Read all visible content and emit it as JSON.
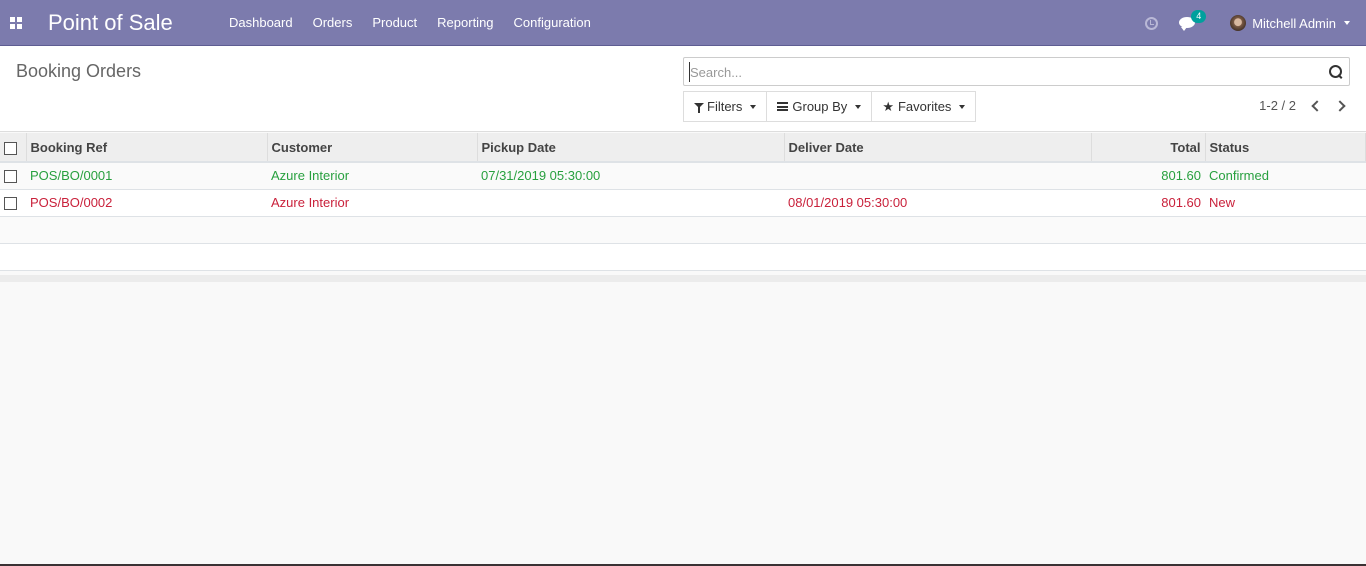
{
  "navbar": {
    "app_title": "Point of Sale",
    "menu": [
      "Dashboard",
      "Orders",
      "Product",
      "Reporting",
      "Configuration"
    ],
    "chat_count": "4",
    "user_name": "Mitchell Admin"
  },
  "control_panel": {
    "title": "Booking Orders",
    "search_placeholder": "Search...",
    "search_value": "",
    "filters_label": "Filters",
    "groupby_label": "Group By",
    "favorites_label": "Favorites",
    "pager": "1-2 / 2"
  },
  "table": {
    "columns": [
      "Booking Ref",
      "Customer",
      "Pickup Date",
      "Deliver Date",
      "Total",
      "Status"
    ],
    "rows": [
      {
        "ref": "POS/BO/0001",
        "customer": "Azure Interior",
        "pickup": "07/31/2019 05:30:00",
        "deliver": "",
        "total": "801.60",
        "status": "Confirmed",
        "color": "#28a03f"
      },
      {
        "ref": "POS/BO/0002",
        "customer": "Azure Interior",
        "pickup": "",
        "deliver": "08/01/2019 05:30:00",
        "total": "801.60",
        "status": "New",
        "color": "#c9213b"
      }
    ]
  },
  "colors": {
    "navbar": "#7c7bad",
    "confirmed": "#28a03f",
    "new": "#c9213b",
    "badge": "#00a09d"
  }
}
